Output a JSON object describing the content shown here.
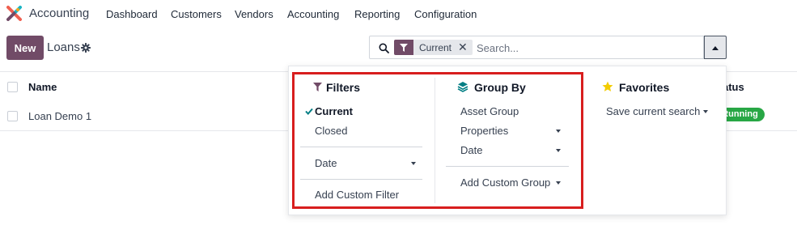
{
  "app": {
    "name": "Accounting"
  },
  "nav": {
    "items": [
      "Dashboard",
      "Customers",
      "Vendors",
      "Accounting",
      "Reporting",
      "Configuration"
    ]
  },
  "control": {
    "new_label": "New",
    "breadcrumb": "Loans"
  },
  "search": {
    "facet_value": "Current",
    "facet_remove": "✕",
    "placeholder": "Search..."
  },
  "list": {
    "columns": {
      "name": "Name",
      "status": "atus"
    },
    "rows": [
      {
        "name": "Loan Demo 1",
        "status": "Running"
      }
    ]
  },
  "dropdown": {
    "filters": {
      "title": "Filters",
      "items": [
        {
          "label": "Current",
          "checked": true
        },
        {
          "label": "Closed"
        }
      ],
      "date_label": "Date",
      "custom_label": "Add Custom Filter"
    },
    "groupby": {
      "title": "Group By",
      "items": [
        {
          "label": "Asset Group"
        },
        {
          "label": "Properties"
        },
        {
          "label": "Date"
        }
      ],
      "custom_label": "Add Custom Group"
    },
    "favorites": {
      "title": "Favorites",
      "save_label": "Save current search"
    }
  },
  "colors": {
    "brand": "#714b67",
    "success": "#28a745",
    "highlight": "#d81e1e",
    "star": "#f3cc00"
  }
}
